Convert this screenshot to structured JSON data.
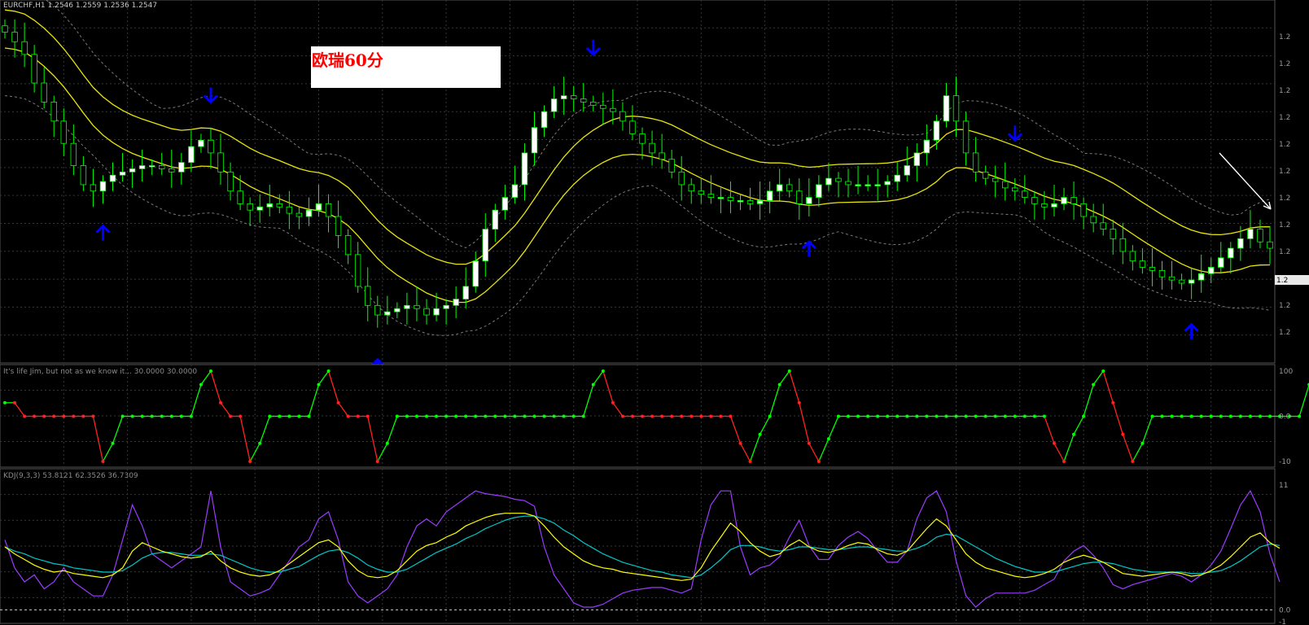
{
  "window": {
    "symbol_header": "EURCHF,H1  1.2546 1.2559 1.2536 1.2547",
    "note": "欧瑞60分",
    "price_tag": "1.2"
  },
  "colors": {
    "background": "#000000",
    "grid": "#33383a",
    "bull_candle": "#ffffff",
    "bear_candle": "#000000",
    "wick": "#00ff00",
    "ma_band": "#e8e40c",
    "bollinger": "#7a7a7a",
    "arrow": "#0000ff",
    "signal_up": "#00ff00",
    "signal_down": "#ff2222",
    "k_line": "#ffff00",
    "d_line": "#00c8c8",
    "j_line": "#9a3cff"
  },
  "panels": {
    "price": {
      "labels": [
        "1.2",
        "1.2",
        "1.2",
        "1.2",
        "1.2",
        "1.2",
        "1.2",
        "1.2",
        "1.2",
        "1.2",
        "1.2",
        "1.2"
      ]
    },
    "indicator": {
      "title": "It's life Jim, but not as we know it...  30.0000  30.0000",
      "labels": [
        "100",
        "0.0",
        "-10"
      ]
    },
    "kdj": {
      "title": "KDJ(9,3,3) 53.8121 62.3526 36.7309",
      "labels": [
        "11",
        "0.0",
        "-1"
      ]
    }
  },
  "chart_data": [
    {
      "type": "candlestick",
      "symbol": "EURCHF",
      "timeframe": "H1",
      "series": [
        {
          "name": "price",
          "values": [
            120,
            117,
            113,
            104,
            98,
            92,
            85,
            78,
            72,
            70,
            73,
            75,
            76,
            77,
            78,
            78,
            77,
            76,
            79,
            84,
            86,
            82,
            76,
            70,
            66,
            64,
            65,
            66,
            65,
            63,
            62,
            64,
            66,
            62,
            56,
            50,
            40,
            34,
            31,
            32,
            33,
            34,
            33,
            31,
            33,
            34,
            36,
            40,
            48,
            58,
            64,
            68,
            72,
            82,
            90,
            95,
            99,
            100,
            99,
            98,
            97,
            96,
            95,
            92,
            88,
            85,
            82,
            80,
            76,
            72,
            70,
            69,
            68,
            68,
            67,
            67,
            66,
            67,
            70,
            72,
            70,
            66,
            68,
            72,
            74,
            73,
            72,
            72,
            72,
            72,
            73,
            75,
            78,
            82,
            86,
            92,
            100,
            92,
            82,
            76,
            74,
            73,
            71,
            70,
            68,
            66,
            65,
            66,
            68,
            66,
            62,
            60,
            58,
            55,
            51,
            48,
            46,
            45,
            43,
            42,
            41,
            42,
            44,
            46,
            49,
            52,
            55,
            58,
            54,
            52
          ]
        }
      ],
      "arrows_down": [
        21,
        60,
        103,
        131
      ],
      "arrows_up": [
        10,
        38,
        82,
        121
      ]
    },
    {
      "type": "line",
      "title": "It's life Jim, but not as we know it...",
      "series": [
        {
          "name": "signal",
          "values": [
            30,
            30,
            0,
            0,
            0,
            0,
            0,
            0,
            0,
            0,
            -100,
            -60,
            0,
            0,
            0,
            0,
            0,
            0,
            0,
            0,
            70,
            100,
            30,
            0,
            0,
            -100,
            -60,
            0,
            0,
            0,
            0,
            0,
            70,
            100,
            30,
            0,
            0,
            0,
            -100,
            -60,
            0,
            0,
            0,
            0,
            0,
            0,
            0,
            0,
            0,
            0,
            0,
            0,
            0,
            0,
            0,
            0,
            0,
            0,
            0,
            0,
            70,
            100,
            30,
            0,
            0,
            0,
            0,
            0,
            0,
            0,
            0,
            0,
            0,
            0,
            0,
            -60,
            -100,
            -40,
            0,
            70,
            100,
            30,
            -60,
            -100,
            -50,
            0,
            0,
            0,
            0,
            0,
            0,
            0,
            0,
            0,
            0,
            0,
            0,
            0,
            0,
            0,
            0,
            0,
            0,
            0,
            0,
            0,
            0,
            -60,
            -100,
            -40,
            0,
            70,
            100,
            30,
            -40,
            -100,
            -60,
            0,
            0,
            0,
            0,
            0,
            0,
            0,
            0,
            0,
            0,
            0,
            0,
            0,
            0,
            0,
            0,
            70,
            100,
            30,
            0
          ]
        }
      ]
    },
    {
      "type": "line",
      "title": "KDJ(9,3,3)",
      "series": [
        {
          "name": "K",
          "values": [
            55,
            50,
            46,
            42,
            39,
            37,
            38,
            36,
            35,
            34,
            33,
            35,
            40,
            52,
            58,
            55,
            52,
            50,
            48,
            47,
            48,
            52,
            45,
            40,
            37,
            35,
            34,
            35,
            38,
            43,
            48,
            53,
            58,
            60,
            55,
            45,
            38,
            34,
            33,
            34,
            38,
            45,
            52,
            56,
            58,
            62,
            65,
            70,
            73,
            76,
            78,
            79,
            79,
            79,
            77,
            70,
            62,
            55,
            50,
            45,
            42,
            40,
            39,
            37,
            36,
            35,
            34,
            33,
            32,
            31,
            32,
            40,
            52,
            62,
            72,
            66,
            58,
            52,
            48,
            50,
            56,
            60,
            55,
            52,
            51,
            53,
            56,
            58,
            57,
            53,
            50,
            49,
            52,
            60,
            68,
            75,
            70,
            60,
            50,
            44,
            40,
            38,
            36,
            34,
            33,
            34,
            36,
            39,
            44,
            47,
            49,
            47,
            44,
            40,
            36,
            35,
            34,
            35,
            36,
            37,
            36,
            34,
            35,
            38,
            42,
            48,
            55,
            62,
            65,
            58,
            54
          ]
        },
        {
          "name": "D",
          "values": [
            55,
            52,
            50,
            47,
            45,
            43,
            42,
            40,
            39,
            38,
            37,
            37,
            38,
            42,
            47,
            50,
            51,
            51,
            50,
            49,
            49,
            50,
            49,
            46,
            43,
            40,
            38,
            37,
            37,
            39,
            41,
            45,
            49,
            52,
            53,
            51,
            47,
            42,
            39,
            37,
            37,
            39,
            43,
            47,
            51,
            54,
            57,
            61,
            64,
            68,
            71,
            74,
            76,
            77,
            77,
            75,
            72,
            67,
            63,
            58,
            54,
            50,
            47,
            44,
            42,
            40,
            38,
            37,
            35,
            34,
            33,
            35,
            40,
            46,
            53,
            56,
            56,
            55,
            53,
            52,
            53,
            55,
            55,
            54,
            53,
            53,
            54,
            55,
            55,
            54,
            53,
            52,
            52,
            54,
            57,
            62,
            64,
            63,
            59,
            55,
            51,
            47,
            44,
            41,
            39,
            37,
            37,
            37,
            39,
            41,
            43,
            44,
            44,
            43,
            41,
            39,
            38,
            37,
            37,
            37,
            37,
            36,
            36,
            37,
            38,
            41,
            45,
            50,
            55,
            57,
            56
          ]
        },
        {
          "name": "J",
          "values": [
            60,
            40,
            30,
            35,
            25,
            30,
            40,
            30,
            25,
            20,
            20,
            35,
            60,
            85,
            70,
            50,
            45,
            40,
            45,
            50,
            55,
            95,
            55,
            30,
            25,
            20,
            22,
            25,
            35,
            45,
            55,
            60,
            75,
            80,
            60,
            30,
            20,
            15,
            20,
            25,
            35,
            55,
            70,
            75,
            70,
            80,
            85,
            90,
            95,
            93,
            92,
            91,
            89,
            88,
            84,
            55,
            35,
            25,
            15,
            12,
            12,
            14,
            18,
            22,
            24,
            25,
            26,
            26,
            24,
            22,
            25,
            60,
            85,
            95,
            95,
            55,
            35,
            40,
            42,
            48,
            62,
            74,
            56,
            46,
            46,
            56,
            62,
            66,
            61,
            52,
            44,
            44,
            52,
            75,
            90,
            95,
            80,
            45,
            20,
            12,
            18,
            22,
            22,
            22,
            22,
            24,
            28,
            32,
            45,
            52,
            56,
            49,
            40,
            28,
            25,
            28,
            30,
            32,
            34,
            36,
            34,
            30,
            35,
            42,
            52,
            68,
            85,
            95,
            80,
            50,
            30
          ]
        }
      ]
    }
  ]
}
